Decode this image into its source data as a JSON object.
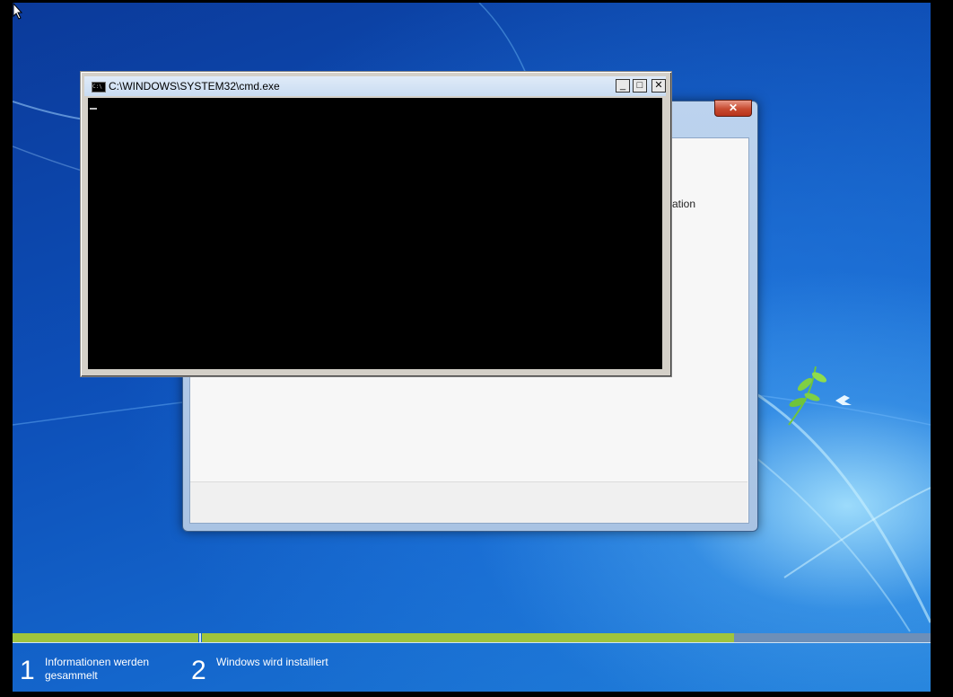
{
  "cmd_window": {
    "title": "C:\\WINDOWS\\SYSTEM32\\cmd.exe",
    "icon_label": "C:\\",
    "buttons": {
      "minimize": "_",
      "maximize": "□",
      "close": "✕"
    }
  },
  "setup_dialog": {
    "partial_text": "ation",
    "close_glyph": "✕"
  },
  "progress": {
    "step1_fraction": 1.0,
    "step2_fraction": 0.73
  },
  "steps": [
    {
      "number": "1",
      "label": "Informationen werden gesammelt"
    },
    {
      "number": "2",
      "label": "Windows wird installiert"
    }
  ],
  "colors": {
    "progress_fill": "#9fc43d",
    "desktop_blue": "#1466cc"
  }
}
